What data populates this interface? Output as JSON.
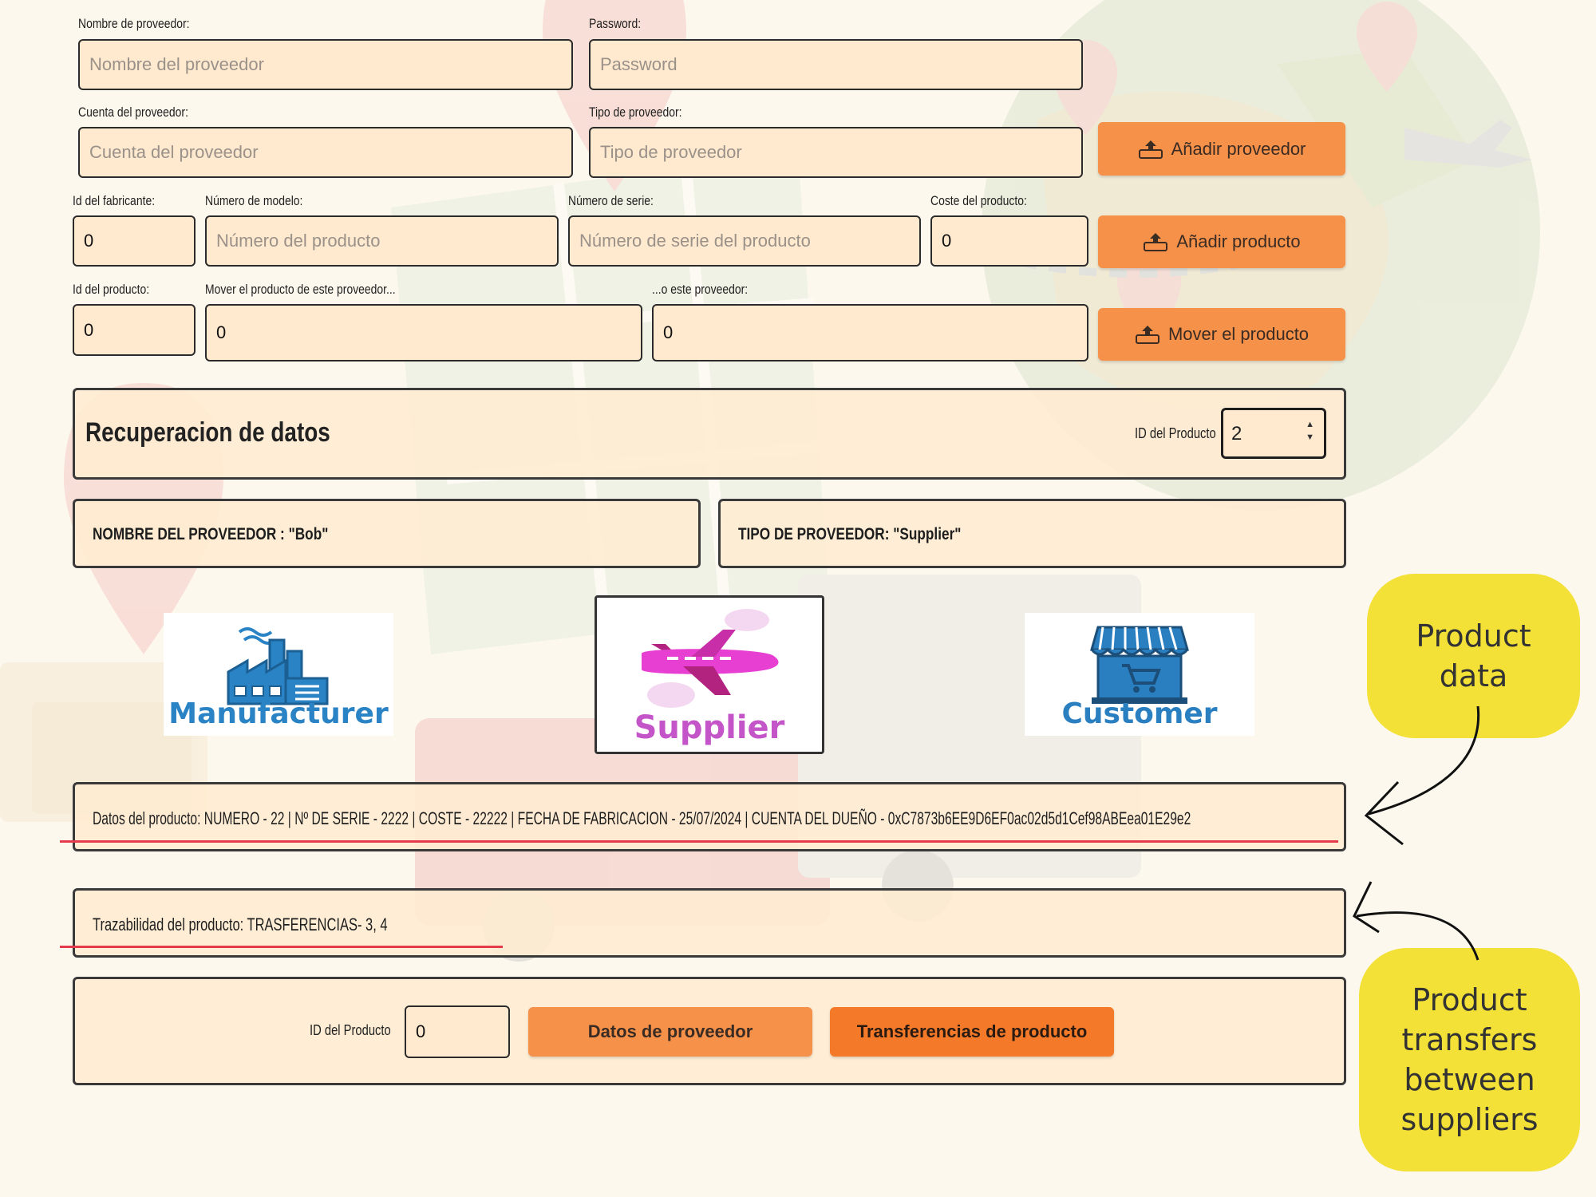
{
  "form": {
    "provider_name": {
      "label": "Nombre de proveedor:",
      "placeholder": "Nombre del proveedor",
      "value": ""
    },
    "password": {
      "label": "Password:",
      "placeholder": "Password",
      "value": ""
    },
    "provider_account": {
      "label": "Cuenta del proveedor:",
      "placeholder": "Cuenta del proveedor",
      "value": ""
    },
    "provider_type": {
      "label": "Tipo de proveedor:",
      "placeholder": "Tipo de proveedor",
      "value": ""
    },
    "add_provider_button": "Añadir proveedor",
    "manufacturer_id": {
      "label": "Id del fabricante:",
      "value": "0"
    },
    "model_number": {
      "label": "Número de modelo:",
      "placeholder": "Número del producto",
      "value": ""
    },
    "serial_number": {
      "label": "Número de serie:",
      "placeholder": "Número de serie del producto",
      "value": ""
    },
    "product_cost": {
      "label": "Coste del producto:",
      "value": "0"
    },
    "add_product_button": "Añadir producto",
    "product_id": {
      "label": "Id del producto:",
      "value": "0"
    },
    "move_from": {
      "label": "Mover el producto de este proveedor...",
      "value": "0"
    },
    "move_to": {
      "label": "...o este proveedor:",
      "value": "0"
    },
    "move_product_button": "Mover el producto"
  },
  "retrieval": {
    "title": "Recuperacion de datos",
    "product_id_label": "ID del Producto",
    "product_id_value": "2"
  },
  "provider_info": {
    "name": "NOMBRE DEL PROVEEDOR : \"Bob\"",
    "type": "TIPO DE PROVEEDOR: \"Supplier\""
  },
  "roles": {
    "manufacturer": "Manufacturer",
    "supplier": "Supplier",
    "customer": "Customer"
  },
  "product_data": "Datos del producto: NUMERO - 22  |  Nº DE SERIE - 2222  |  COSTE - 22222  |  FECHA DE FABRICACION - 25/07/2024  |  CUENTA DEL DUEÑO - 0xC7873b6EE9D6EF0ac02d5d1Cef98ABEea01E29e2",
  "traceability": "Trazabilidad del producto: TRASFERENCIAS-    3,     4",
  "query": {
    "product_id_label": "ID del Producto",
    "product_id_value": "0",
    "provider_data_button": "Datos de proveedor",
    "transfers_button": "Transferencias de producto"
  },
  "annotations": {
    "product_data": "Product\ndata",
    "transfers": "Product\ntransfers\nbetween\nsuppliers"
  },
  "colors": {
    "accent_orange": "#f6914a",
    "accent_dark_orange": "#f47a2a",
    "field_bg": "#ffe9cf",
    "bubble_yellow": "#f3e137",
    "underline_red": "#e43a4c",
    "manufacturer_blue": "#2a83c4",
    "supplier_pink": "#c455c8",
    "customer_blue": "#2a7fc1"
  }
}
